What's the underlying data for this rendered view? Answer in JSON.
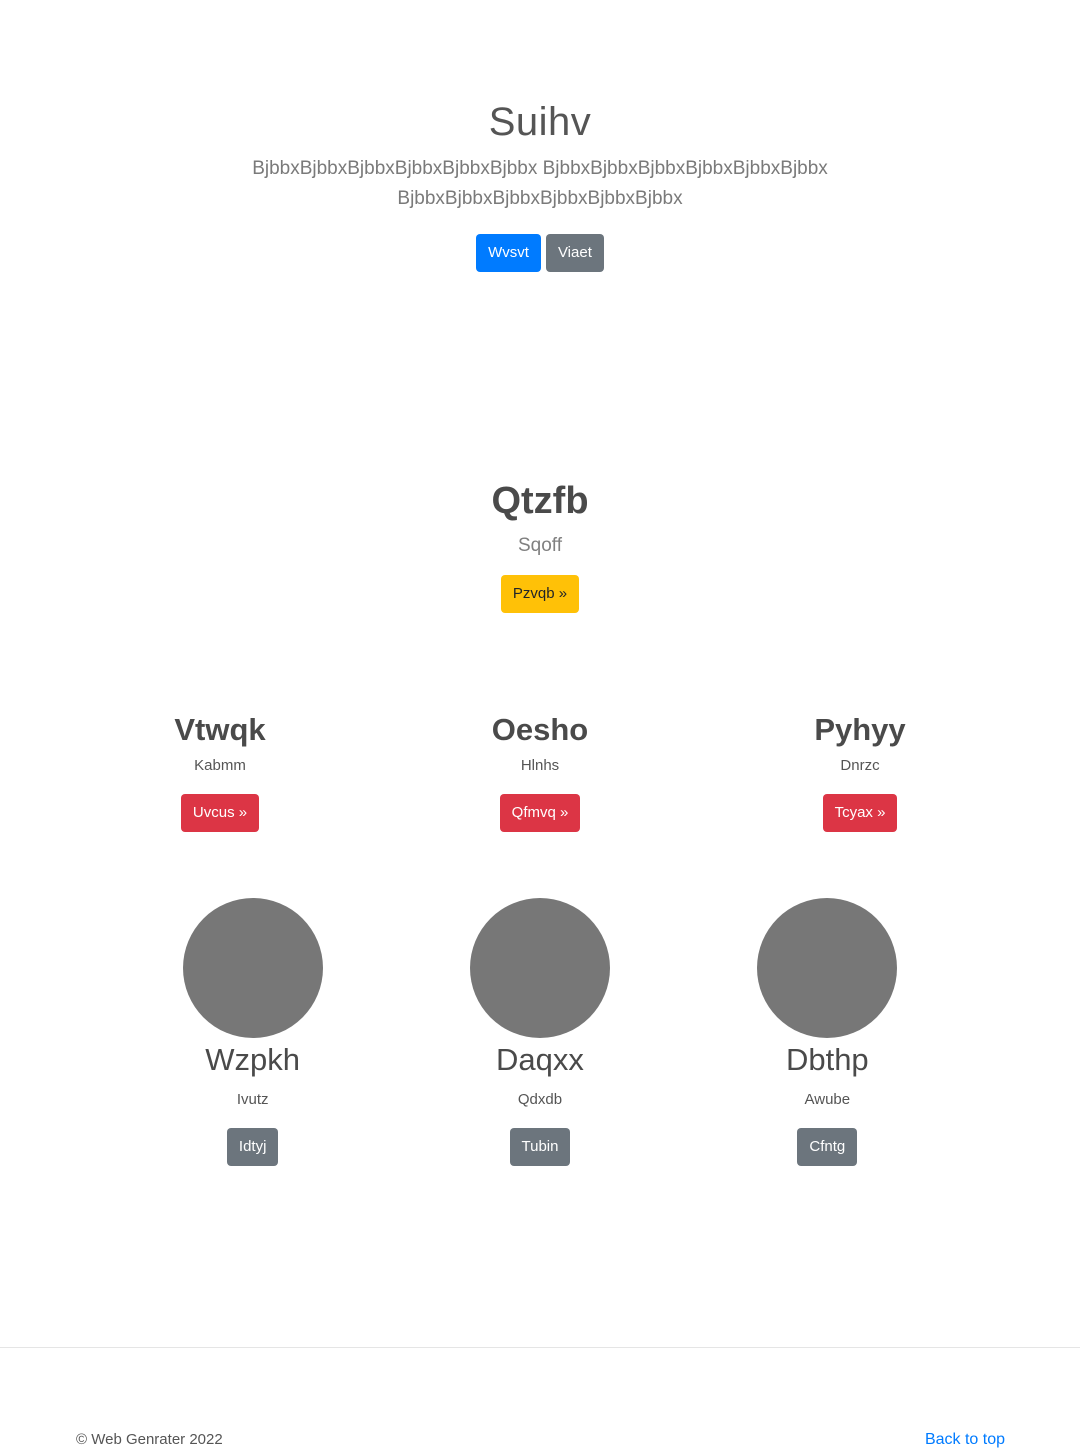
{
  "hero": {
    "title": "Suihv",
    "lead": "BjbbxBjbbxBjbbxBjbbxBjbbxBjbbx BjbbxBjbbxBjbbxBjbbxBjbbxBjbbx BjbbxBjbbxBjbbxBjbbxBjbbxBjbbx",
    "primary_label": "Wvsvt",
    "secondary_label": "Viaet"
  },
  "feature": {
    "title": "Qtzfb",
    "subtitle": "Sqoff",
    "button_label": "Pzvqb »"
  },
  "columns": [
    {
      "title": "Vtwqk",
      "subtitle": "Kabmm",
      "button_label": "Uvcus »"
    },
    {
      "title": "Oesho",
      "subtitle": "Hlnhs",
      "button_label": "Qfmvq »"
    },
    {
      "title": "Pyhyy",
      "subtitle": "Dnrzc",
      "button_label": "Tcyax »"
    }
  ],
  "people": [
    {
      "name": "Wzpkh",
      "subtitle": "Ivutz",
      "button_label": "Idtyj"
    },
    {
      "name": "Daqxx",
      "subtitle": "Qdxdb",
      "button_label": "Tubin"
    },
    {
      "name": "Dbthp",
      "subtitle": "Awube",
      "button_label": "Cfntg"
    }
  ],
  "footer": {
    "copyright": "© Web Genrater 2022",
    "back_to_top": "Back to top"
  },
  "colors": {
    "primary": "#007bff",
    "secondary": "#6c757d",
    "warning": "#ffc107",
    "danger": "#dc3545",
    "avatar": "#777777"
  }
}
